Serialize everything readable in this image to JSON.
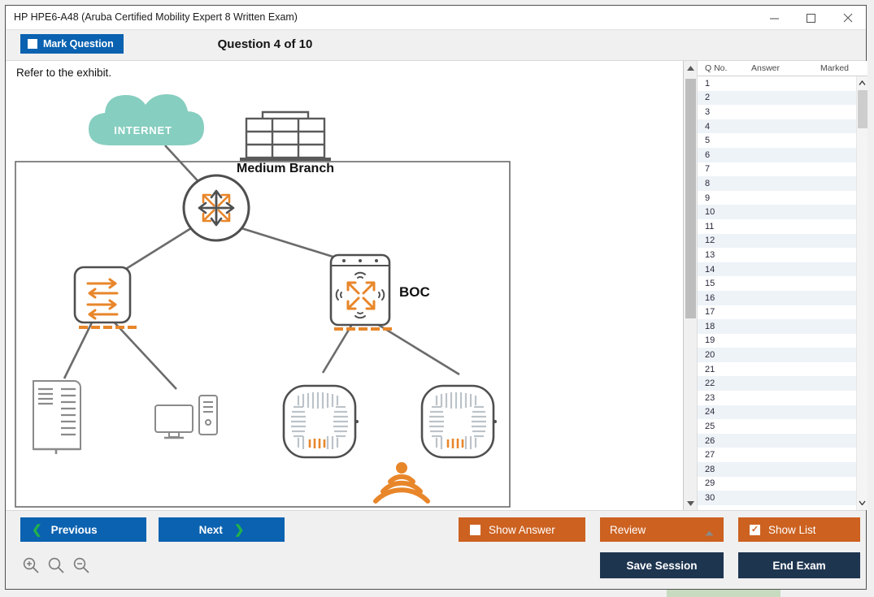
{
  "window": {
    "title": "HP HPE6-A48 (Aruba Certified Mobility Expert 8 Written Exam)",
    "controls": [
      {
        "name": "minimize",
        "glyph": "minimize-icon"
      },
      {
        "name": "maximize",
        "glyph": "maximize-icon"
      },
      {
        "name": "close",
        "glyph": "close-icon"
      }
    ]
  },
  "header": {
    "mark_label": "Mark Question",
    "mark_checked": false,
    "question_title": "Question 4 of 10"
  },
  "main": {
    "prompt": "Refer to the exhibit.",
    "exhibit": {
      "cloud_label": "INTERNET",
      "cloud_color": "#86cec0",
      "building_label": "Medium Branch",
      "controller_label": "BOC",
      "accent_color": "#e8862a",
      "line_color": "#6b6b6b",
      "nodes": [
        {
          "name": "internet-cloud",
          "label": "INTERNET"
        },
        {
          "name": "medium-branch-building",
          "label": "Medium Branch"
        },
        {
          "name": "router",
          "label": ""
        },
        {
          "name": "switch",
          "label": ""
        },
        {
          "name": "branch-office-controller",
          "label": "BOC"
        },
        {
          "name": "server-rack",
          "label": ""
        },
        {
          "name": "desktop-computer",
          "label": ""
        },
        {
          "name": "access-point-left",
          "label": ""
        },
        {
          "name": "access-point-right",
          "label": ""
        },
        {
          "name": "wifi-signal",
          "label": ""
        }
      ]
    }
  },
  "question_list": {
    "columns": [
      "Q No.",
      "Answer",
      "Marked"
    ],
    "rows": [
      {
        "q": "1",
        "answer": "",
        "marked": ""
      },
      {
        "q": "2",
        "answer": "",
        "marked": ""
      },
      {
        "q": "3",
        "answer": "",
        "marked": ""
      },
      {
        "q": "4",
        "answer": "",
        "marked": ""
      },
      {
        "q": "5",
        "answer": "",
        "marked": ""
      },
      {
        "q": "6",
        "answer": "",
        "marked": ""
      },
      {
        "q": "7",
        "answer": "",
        "marked": ""
      },
      {
        "q": "8",
        "answer": "",
        "marked": ""
      },
      {
        "q": "9",
        "answer": "",
        "marked": ""
      },
      {
        "q": "10",
        "answer": "",
        "marked": ""
      },
      {
        "q": "11",
        "answer": "",
        "marked": ""
      },
      {
        "q": "12",
        "answer": "",
        "marked": ""
      },
      {
        "q": "13",
        "answer": "",
        "marked": ""
      },
      {
        "q": "14",
        "answer": "",
        "marked": ""
      },
      {
        "q": "15",
        "answer": "",
        "marked": ""
      },
      {
        "q": "16",
        "answer": "",
        "marked": ""
      },
      {
        "q": "17",
        "answer": "",
        "marked": ""
      },
      {
        "q": "18",
        "answer": "",
        "marked": ""
      },
      {
        "q": "19",
        "answer": "",
        "marked": ""
      },
      {
        "q": "20",
        "answer": "",
        "marked": ""
      },
      {
        "q": "21",
        "answer": "",
        "marked": ""
      },
      {
        "q": "22",
        "answer": "",
        "marked": ""
      },
      {
        "q": "23",
        "answer": "",
        "marked": ""
      },
      {
        "q": "24",
        "answer": "",
        "marked": ""
      },
      {
        "q": "25",
        "answer": "",
        "marked": ""
      },
      {
        "q": "26",
        "answer": "",
        "marked": ""
      },
      {
        "q": "27",
        "answer": "",
        "marked": ""
      },
      {
        "q": "28",
        "answer": "",
        "marked": ""
      },
      {
        "q": "29",
        "answer": "",
        "marked": ""
      },
      {
        "q": "30",
        "answer": "",
        "marked": ""
      }
    ]
  },
  "footer": {
    "previous_label": "Previous",
    "next_label": "Next",
    "show_answer_label": "Show Answer",
    "show_answer_checked": false,
    "review_label": "Review",
    "show_list_label": "Show List",
    "show_list_checked": true,
    "save_session_label": "Save Session",
    "end_exam_label": "End Exam",
    "zoom_controls": [
      {
        "name": "zoom-in-icon"
      },
      {
        "name": "zoom-reset-icon"
      },
      {
        "name": "zoom-out-icon"
      }
    ]
  },
  "colors": {
    "primary_blue": "#0a62b0",
    "accent_orange": "#cc6120",
    "navy": "#1e3550",
    "chevron_green": "#22b14c"
  }
}
